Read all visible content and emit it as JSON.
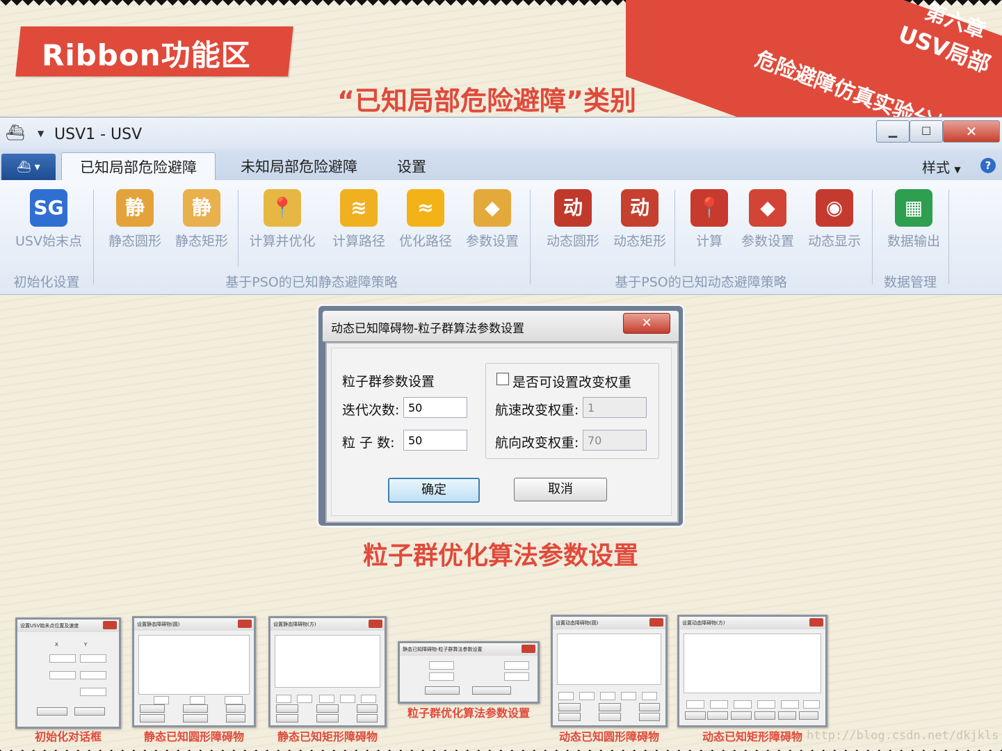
{
  "banner": {
    "title": "Ribbon功能区",
    "subtitle": "“已知局部危险避障”类别"
  },
  "corner": {
    "line1": "第六章",
    "line2": "USV局部",
    "line3": "危险避障仿真实验分析"
  },
  "window": {
    "title": "USV1 - USV",
    "tabs": [
      "已知局部危险避障",
      "未知局部危险避障",
      "设置"
    ],
    "style_label": "样式",
    "buttons": [
      {
        "label": "USV始末点",
        "color": "#2f6fd1"
      },
      {
        "label": "静态圆形",
        "color": "#e3a23a"
      },
      {
        "label": "静态矩形",
        "color": "#e9b04e"
      },
      {
        "label": "计算并优化",
        "color": "#e6b843"
      },
      {
        "label": "计算路径",
        "color": "#f0b020"
      },
      {
        "label": "优化路径",
        "color": "#f3b318"
      },
      {
        "label": "参数设置",
        "color": "#e3a93b"
      },
      {
        "label": "动态圆形",
        "color": "#c0392b"
      },
      {
        "label": "动态矩形",
        "color": "#c64030"
      },
      {
        "label": "计算",
        "color": "#c73a2e"
      },
      {
        "label": "参数设置",
        "color": "#d24436"
      },
      {
        "label": "动态显示",
        "color": "#c53a2f"
      },
      {
        "label": "数据输出",
        "color": "#2e9e4f"
      }
    ],
    "groups": [
      "初始化设置",
      "基于PSO的已知静态避障策略",
      "基于PSO的已知动态避障策略",
      "数据管理"
    ]
  },
  "dialog": {
    "title": "动态已知障碍物-粒子群算法参数设置",
    "section": "粒子群参数设置",
    "iter_label": "迭代次数:",
    "iter_value": "50",
    "particle_label": "粒 子 数:",
    "particle_value": "50",
    "weight_check": "是否可设置改变权重",
    "speed_label": "航速改变权重:",
    "speed_value": "1",
    "heading_label": "航向改变权重:",
    "heading_value": "70",
    "ok": "确定",
    "cancel": "取消"
  },
  "caption": "粒子群优化算法参数设置",
  "thumbnails": [
    {
      "caption": "初始化对话框",
      "title": "设置USV始末点位置及速度"
    },
    {
      "caption": "静态已知圆形障碍物",
      "title": "设置静态障碍物(圆)"
    },
    {
      "caption": "静态已知矩形障碍物",
      "title": "设置静态障碍物(方)"
    },
    {
      "caption": "粒子群优化算法参数设置",
      "title": "静态已知障碍物-粒子群算法参数设置"
    },
    {
      "caption": "动态已知圆形障碍物",
      "title": "设置动态障碍物(圆)"
    },
    {
      "caption": "动态已知矩形障碍物",
      "title": "设置动态障碍物(方)"
    }
  ],
  "watermark": "http://blog.csdn.net/dkjkls"
}
